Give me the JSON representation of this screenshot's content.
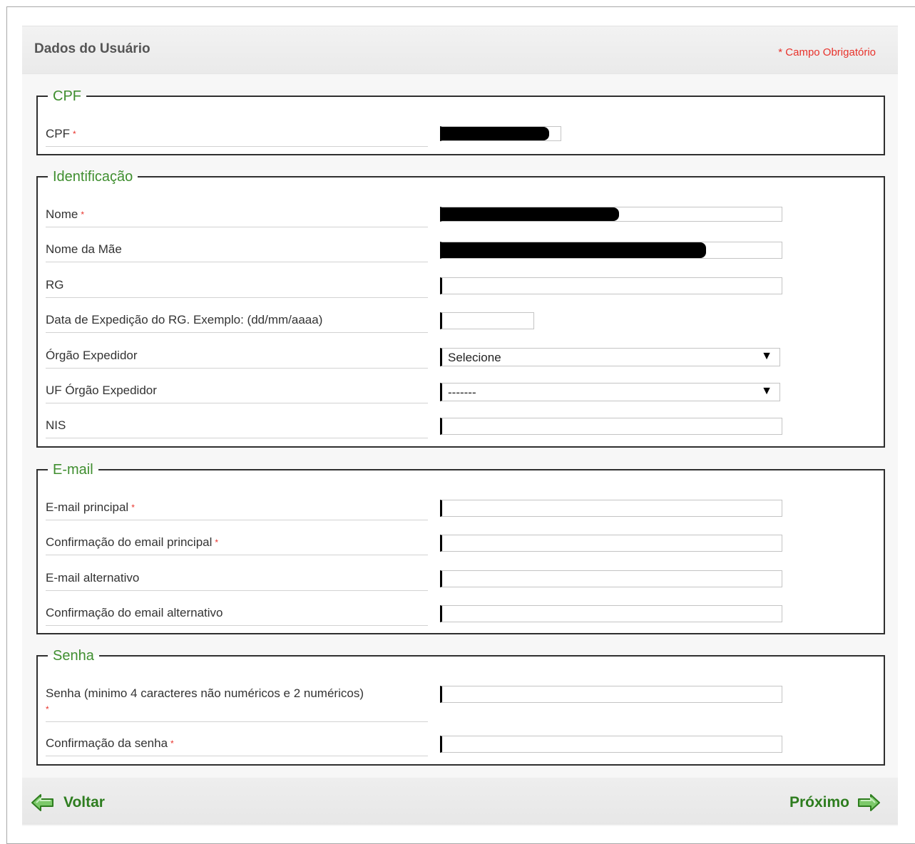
{
  "header": {
    "title": "Dados do Usuário",
    "required_note": "* Campo Obrigatório"
  },
  "sections": {
    "cpf": {
      "legend": "CPF",
      "cpf_label": "CPF"
    },
    "identificacao": {
      "legend": "Identificação",
      "nome_label": "Nome",
      "mae_label": "Nome da Mãe",
      "rg_label": "RG",
      "data_label": "Data de Expedição do RG. Exemplo: (dd/mm/aaaa)",
      "orgao_label": "Órgão Expedidor",
      "orgao_value": "Selecione",
      "uf_label": "UF Órgão Expedidor",
      "uf_value": "-------",
      "nis_label": "NIS"
    },
    "email": {
      "legend": "E-mail",
      "principal_label": "E-mail principal",
      "conf_principal_label": "Confirmação do email principal",
      "alternativo_label": "E-mail alternativo",
      "conf_alternativo_label": "Confirmação do email alternativo"
    },
    "senha": {
      "legend": "Senha",
      "senha_label": "Senha (minimo 4 caracteres não numéricos e 2 numéricos)",
      "conf_senha_label": "Confirmação da senha"
    }
  },
  "footer": {
    "back_label": "Voltar",
    "next_label": "Próximo"
  },
  "colors": {
    "accent": "#3f8e2f",
    "required": "#e8322b",
    "nav": "#2e7d1f"
  },
  "icons": {
    "back": "arrow-left-icon",
    "next": "arrow-right-icon"
  }
}
